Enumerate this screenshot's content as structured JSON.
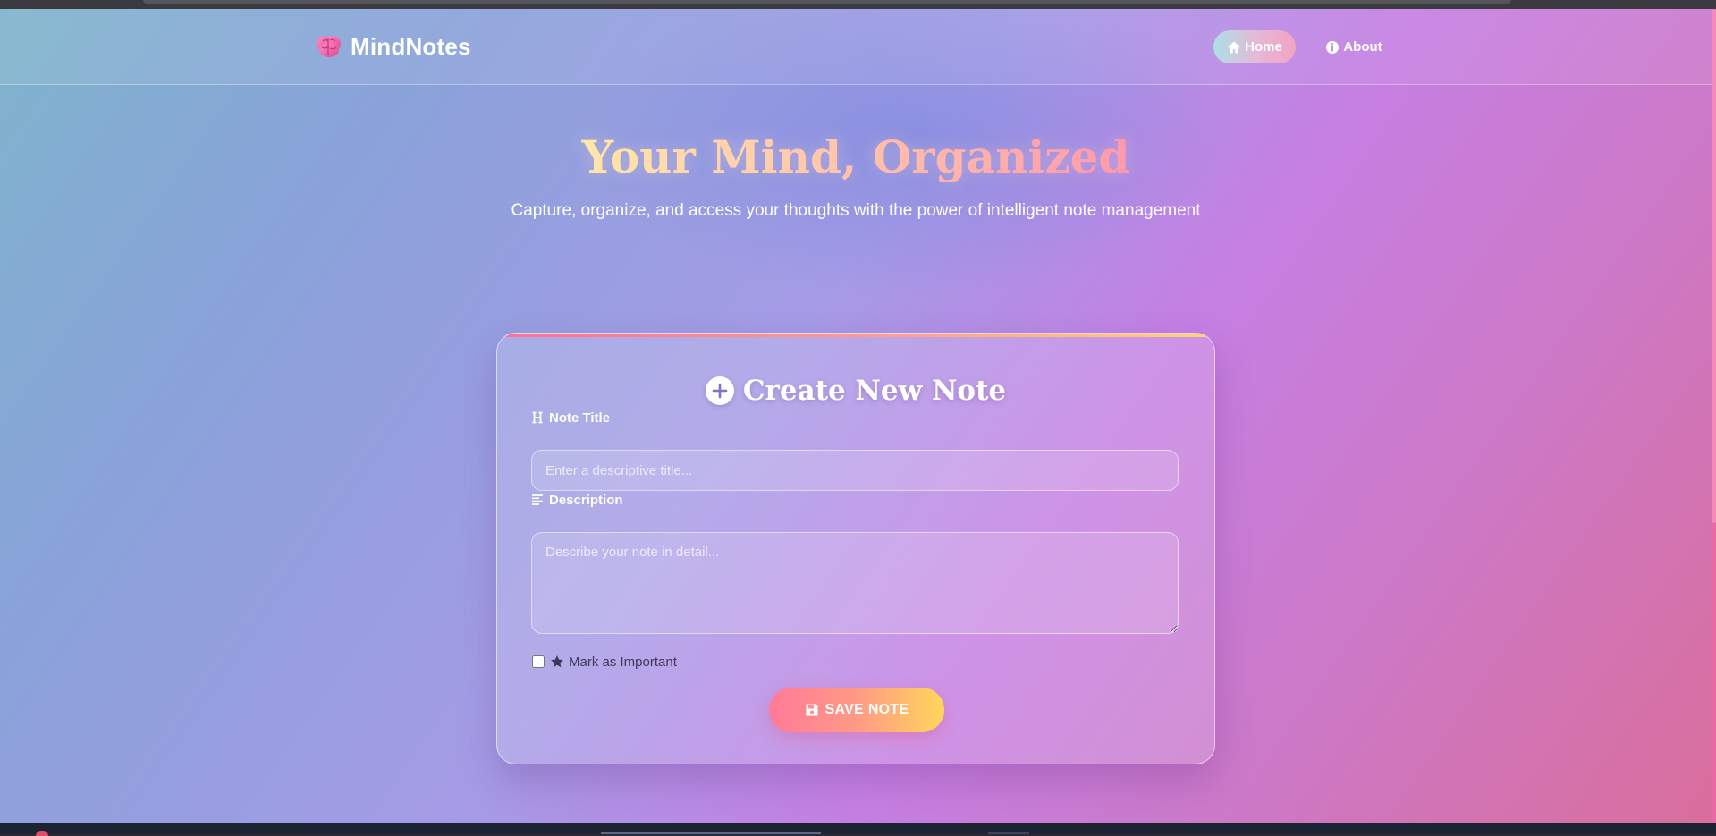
{
  "app": {
    "brand_name": "MindNotes",
    "brand_icon": "brain-icon"
  },
  "nav": {
    "items": [
      {
        "label": "Home",
        "icon": "home-icon",
        "active": true
      },
      {
        "label": "About",
        "icon": "info-icon",
        "active": false
      }
    ]
  },
  "hero": {
    "title": "Your Mind, Organized",
    "subtitle": "Capture, organize, and access your thoughts with the power of intelligent note management"
  },
  "form": {
    "title": "Create New Note",
    "title_icon": "plus-icon",
    "note_title": {
      "label": "Note Title",
      "icon": "heading-icon",
      "value": "",
      "placeholder": "Enter a descriptive title..."
    },
    "description": {
      "label": "Description",
      "icon": "align-left-icon",
      "value": "",
      "placeholder": "Describe your note in detail..."
    },
    "important": {
      "label": "Mark as Important",
      "icon": "star-icon",
      "checked": false
    },
    "save_button": {
      "label": "SAVE NOTE",
      "icon": "save-icon"
    }
  },
  "colors": {
    "accent_gradient_start": "#ff6f91",
    "accent_gradient_end": "#ffd36e",
    "hero_gradient_start": "#ffe9a6",
    "hero_gradient_end": "#ff8fa8",
    "checkbox_label": "#3b3a5c"
  }
}
